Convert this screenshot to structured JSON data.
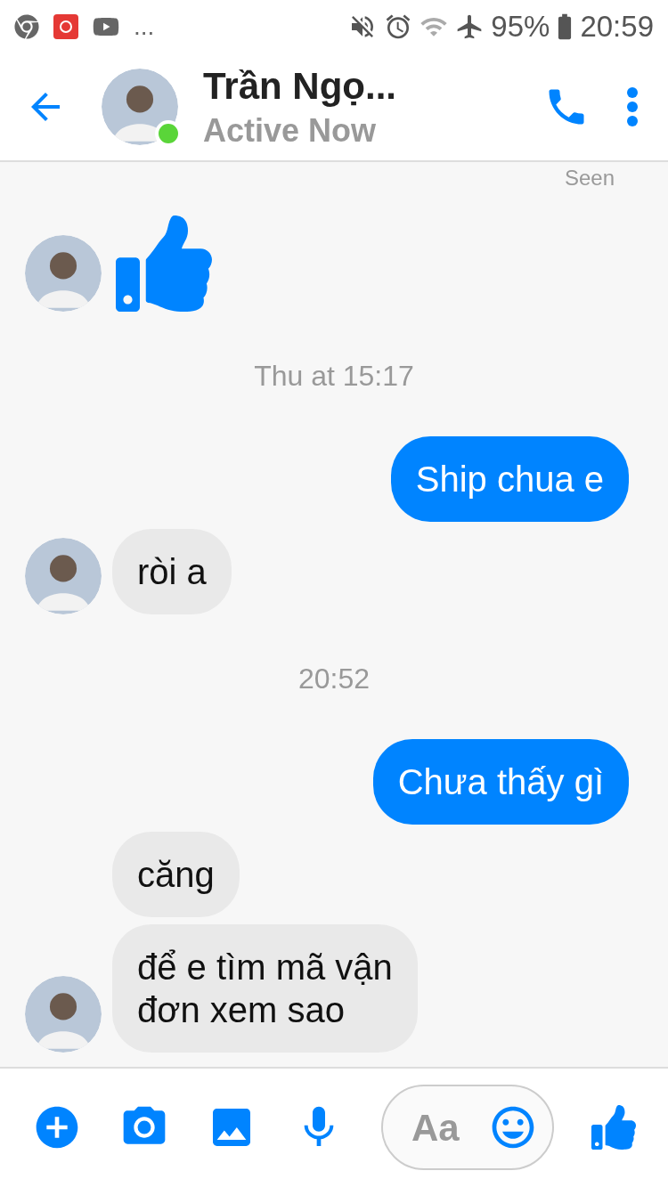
{
  "status_bar": {
    "battery": "95%",
    "time": "20:59",
    "notification_more": "..."
  },
  "header": {
    "name": "Trần Ngọ...",
    "status": "Active Now",
    "online": true
  },
  "messages": [
    {
      "kind": "receipt",
      "text": "Seen"
    },
    {
      "kind": "like",
      "outgoing": false,
      "avatar": true
    },
    {
      "kind": "time",
      "text": "Thu at 15:17"
    },
    {
      "kind": "text",
      "outgoing": true,
      "text": "Ship chua e"
    },
    {
      "kind": "text",
      "outgoing": false,
      "text": "ròi a",
      "avatar": true
    },
    {
      "kind": "time",
      "text": "20:52"
    },
    {
      "kind": "text",
      "outgoing": true,
      "text": "Chưa thấy gì"
    },
    {
      "kind": "text",
      "outgoing": false,
      "text": "căng",
      "avatar": false
    },
    {
      "kind": "text",
      "outgoing": false,
      "text": "để e tìm mã vận\nđơn xem sao",
      "avatar": true
    }
  ],
  "composer": {
    "placeholder": "Aa"
  }
}
